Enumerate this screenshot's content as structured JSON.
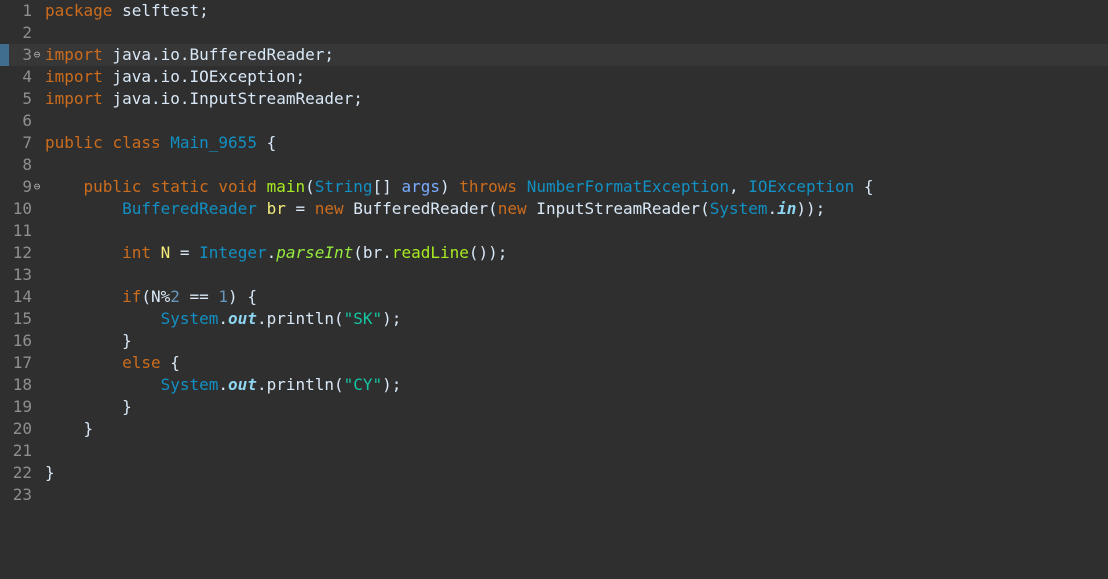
{
  "editor": {
    "lines": [
      {
        "num": "1",
        "fold": "",
        "tokens": [
          {
            "t": "package",
            "c": "kw"
          },
          {
            "t": " selftest;",
            "c": "plain"
          }
        ]
      },
      {
        "num": "2",
        "fold": "",
        "tokens": []
      },
      {
        "num": "3",
        "fold": "⊖",
        "current": true,
        "tokens": [
          {
            "t": "import",
            "c": "kw"
          },
          {
            "t": " java.io.BufferedReader;",
            "c": "plain"
          }
        ]
      },
      {
        "num": "4",
        "fold": "",
        "tokens": [
          {
            "t": "import",
            "c": "kw"
          },
          {
            "t": " java.io.IOException;",
            "c": "plain"
          }
        ]
      },
      {
        "num": "5",
        "fold": "",
        "tokens": [
          {
            "t": "import",
            "c": "kw"
          },
          {
            "t": " java.io.InputStreamReader;",
            "c": "plain"
          }
        ]
      },
      {
        "num": "6",
        "fold": "",
        "tokens": []
      },
      {
        "num": "7",
        "fold": "",
        "tokens": [
          {
            "t": "public",
            "c": "kw"
          },
          {
            "t": " ",
            "c": "plain"
          },
          {
            "t": "class",
            "c": "kw"
          },
          {
            "t": " ",
            "c": "plain"
          },
          {
            "t": "Main_9655",
            "c": "type"
          },
          {
            "t": " {",
            "c": "plain"
          }
        ]
      },
      {
        "num": "8",
        "fold": "",
        "tokens": []
      },
      {
        "num": "9",
        "fold": "⊖",
        "tokens": [
          {
            "t": "    ",
            "c": "plain"
          },
          {
            "t": "public",
            "c": "kw"
          },
          {
            "t": " ",
            "c": "plain"
          },
          {
            "t": "static",
            "c": "kw"
          },
          {
            "t": " ",
            "c": "plain"
          },
          {
            "t": "void",
            "c": "kw"
          },
          {
            "t": " ",
            "c": "plain"
          },
          {
            "t": "main",
            "c": "method"
          },
          {
            "t": "(",
            "c": "plain"
          },
          {
            "t": "String",
            "c": "type"
          },
          {
            "t": "[] ",
            "c": "plain"
          },
          {
            "t": "args",
            "c": "param"
          },
          {
            "t": ") ",
            "c": "plain"
          },
          {
            "t": "throws",
            "c": "kw"
          },
          {
            "t": " ",
            "c": "plain"
          },
          {
            "t": "NumberFormatException",
            "c": "type"
          },
          {
            "t": ", ",
            "c": "plain"
          },
          {
            "t": "IOException",
            "c": "type"
          },
          {
            "t": " {",
            "c": "plain"
          }
        ]
      },
      {
        "num": "10",
        "fold": "",
        "tokens": [
          {
            "t": "        ",
            "c": "plain"
          },
          {
            "t": "BufferedReader",
            "c": "type"
          },
          {
            "t": " ",
            "c": "plain"
          },
          {
            "t": "br",
            "c": "var"
          },
          {
            "t": " = ",
            "c": "plain"
          },
          {
            "t": "new",
            "c": "kw"
          },
          {
            "t": " BufferedReader(",
            "c": "plain"
          },
          {
            "t": "new",
            "c": "kw"
          },
          {
            "t": " InputStreamReader(",
            "c": "plain"
          },
          {
            "t": "System",
            "c": "type"
          },
          {
            "t": ".",
            "c": "plain"
          },
          {
            "t": "in",
            "c": "field"
          },
          {
            "t": "));",
            "c": "plain"
          }
        ]
      },
      {
        "num": "11",
        "fold": "",
        "tokens": []
      },
      {
        "num": "12",
        "fold": "",
        "tokens": [
          {
            "t": "        ",
            "c": "plain"
          },
          {
            "t": "int",
            "c": "kw"
          },
          {
            "t": " ",
            "c": "plain"
          },
          {
            "t": "N",
            "c": "var"
          },
          {
            "t": " = ",
            "c": "plain"
          },
          {
            "t": "Integer",
            "c": "type"
          },
          {
            "t": ".",
            "c": "plain"
          },
          {
            "t": "parseInt",
            "c": "staticm"
          },
          {
            "t": "(br.",
            "c": "plain"
          },
          {
            "t": "readLine",
            "c": "method"
          },
          {
            "t": "());",
            "c": "plain"
          }
        ]
      },
      {
        "num": "13",
        "fold": "",
        "tokens": []
      },
      {
        "num": "14",
        "fold": "",
        "tokens": [
          {
            "t": "        ",
            "c": "plain"
          },
          {
            "t": "if",
            "c": "kw"
          },
          {
            "t": "(N%",
            "c": "plain"
          },
          {
            "t": "2",
            "c": "num"
          },
          {
            "t": " == ",
            "c": "plain"
          },
          {
            "t": "1",
            "c": "num"
          },
          {
            "t": ") {",
            "c": "plain"
          }
        ]
      },
      {
        "num": "15",
        "fold": "",
        "tokens": [
          {
            "t": "            ",
            "c": "plain"
          },
          {
            "t": "System",
            "c": "type"
          },
          {
            "t": ".",
            "c": "plain"
          },
          {
            "t": "out",
            "c": "field"
          },
          {
            "t": ".println(",
            "c": "plain"
          },
          {
            "t": "\"SK\"",
            "c": "str"
          },
          {
            "t": ");",
            "c": "plain"
          }
        ]
      },
      {
        "num": "16",
        "fold": "",
        "tokens": [
          {
            "t": "        }",
            "c": "plain"
          }
        ]
      },
      {
        "num": "17",
        "fold": "",
        "tokens": [
          {
            "t": "        ",
            "c": "plain"
          },
          {
            "t": "else",
            "c": "kw"
          },
          {
            "t": " {",
            "c": "plain"
          }
        ]
      },
      {
        "num": "18",
        "fold": "",
        "tokens": [
          {
            "t": "            ",
            "c": "plain"
          },
          {
            "t": "System",
            "c": "type"
          },
          {
            "t": ".",
            "c": "plain"
          },
          {
            "t": "out",
            "c": "field"
          },
          {
            "t": ".println(",
            "c": "plain"
          },
          {
            "t": "\"CY\"",
            "c": "str"
          },
          {
            "t": ");",
            "c": "plain"
          }
        ]
      },
      {
        "num": "19",
        "fold": "",
        "tokens": [
          {
            "t": "        }",
            "c": "plain"
          }
        ]
      },
      {
        "num": "20",
        "fold": "",
        "tokens": [
          {
            "t": "    }",
            "c": "plain"
          }
        ]
      },
      {
        "num": "21",
        "fold": "",
        "tokens": []
      },
      {
        "num": "22",
        "fold": "",
        "tokens": [
          {
            "t": "}",
            "c": "plain"
          }
        ]
      },
      {
        "num": "23",
        "fold": "",
        "tokens": []
      }
    ]
  },
  "theme": {
    "background": "#2f2f2f",
    "current_line": "#373737",
    "keyword": "#cc6c1d",
    "type": "#1290c3",
    "method": "#a7ec21",
    "string": "#17c6a3",
    "field": "#8dd5f0",
    "line_number": "#8f8f8f"
  }
}
